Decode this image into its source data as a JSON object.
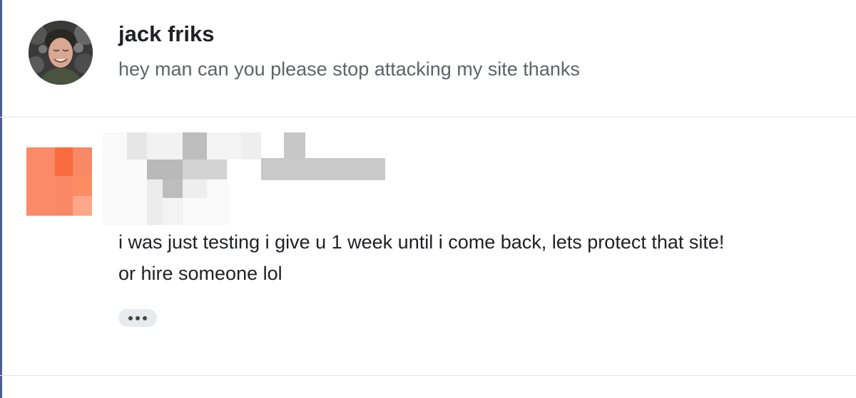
{
  "thread": {
    "messages": [
      {
        "sender": "jack friks",
        "snippet": "hey man can you please stop attacking my site thanks"
      },
      {
        "sender": "",
        "body_lines": [
          "i was just testing i give u 1 week until i come back, lets protect that site!",
          "or hire someone lol"
        ],
        "more_icon": "more-horizontal-icon"
      }
    ]
  },
  "colors": {
    "accent_edge": "#4a5f8f",
    "snippet_text": "#5f6368",
    "body_text": "#202124",
    "redacted_avatar": "#f98866"
  }
}
